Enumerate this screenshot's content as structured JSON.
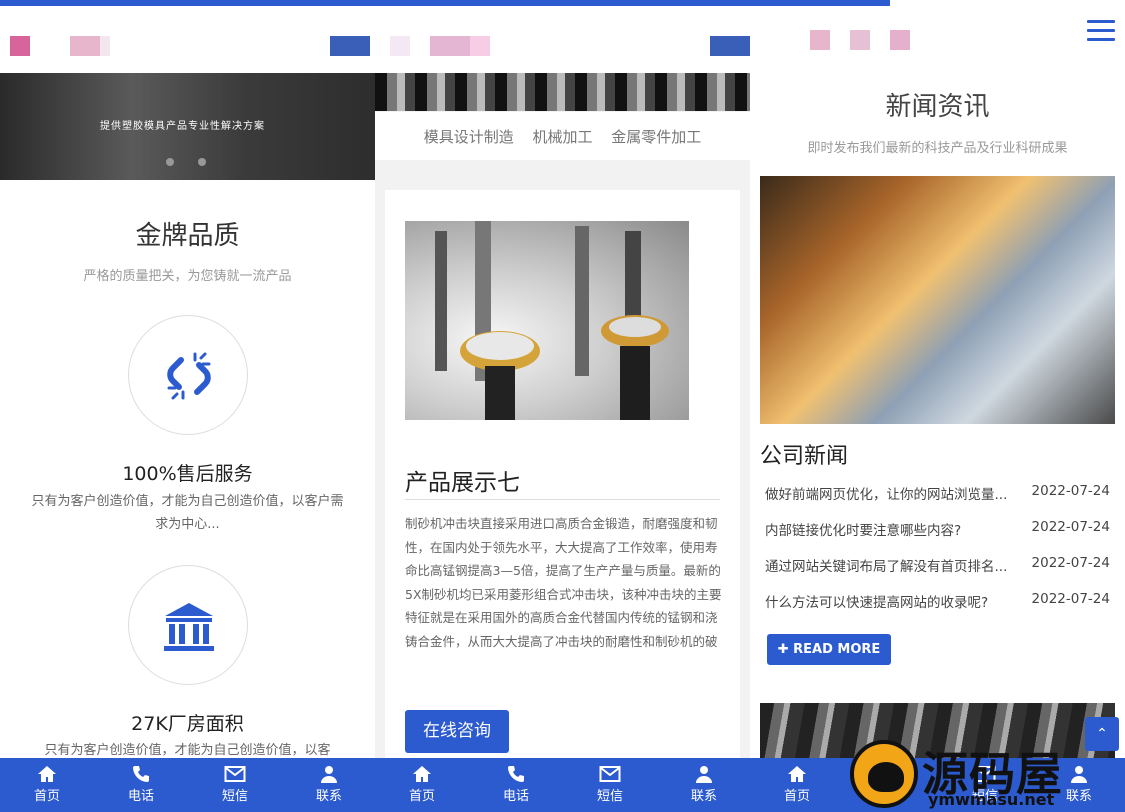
{
  "column1": {
    "banner": {
      "headline": "提供塑胶模具产品专业性解决方案"
    },
    "quality": {
      "title": "金牌品质",
      "subtitle": "严格的质量把关，为您铸就一流产品"
    },
    "features": [
      {
        "icon": "link-icon",
        "title": "100%售后服务",
        "desc": "只有为客户创造价值，才能为自己创造价值，以客户需求为中心..."
      },
      {
        "icon": "bank-icon",
        "title": "27K厂房面积",
        "desc": "只有为客户创造价值，才能为自己创造价值，以客"
      }
    ]
  },
  "column2": {
    "categories": [
      "模具设计制造",
      "机械加工",
      "金属零件加工"
    ],
    "product": {
      "title": "产品展示七",
      "desc": "制砂机冲击块直接采用进口高质合金锻造，耐磨强度和韧性，在国内处于领先水平，大大提高了工作效率，使用寿命比高锰钢提高3—5倍，提高了生产产量与质量。最新的5X制砂机均已采用菱形组合式冲击块，该种冲击块的主要特征就是在采用国外的高质合金代替国内传统的锰钢和浇铸合金件，从而大大提高了冲击块的耐磨性和制砂机的破",
      "consult_label": "在线咨询"
    }
  },
  "column3": {
    "news": {
      "title": "新闻资讯",
      "subtitle": "即时发布我们最新的科技产品及行业科研成果"
    },
    "company_news_label": "公司新闻",
    "items": [
      {
        "title": "做好前端网页优化，让你的网站浏览量...",
        "date": "2022-07-24"
      },
      {
        "title": "内部链接优化时要注意哪些内容?",
        "date": "2022-07-24"
      },
      {
        "title": "通过网站关键词布局了解没有首页排名...",
        "date": "2022-07-24"
      },
      {
        "title": "什么方法可以快速提高网站的收录呢?",
        "date": "2022-07-24"
      }
    ],
    "read_more_label": "READ MORE"
  },
  "bottom_nav": [
    {
      "icon": "home-icon",
      "label": "首页"
    },
    {
      "icon": "phone-icon",
      "label": "电话"
    },
    {
      "icon": "mail-icon",
      "label": "短信"
    },
    {
      "icon": "user-icon",
      "label": "联系"
    }
  ],
  "watermark": {
    "text": "源码屋",
    "domain": "ymwmasu.net"
  },
  "colors": {
    "accent": "#2c5bd0"
  }
}
